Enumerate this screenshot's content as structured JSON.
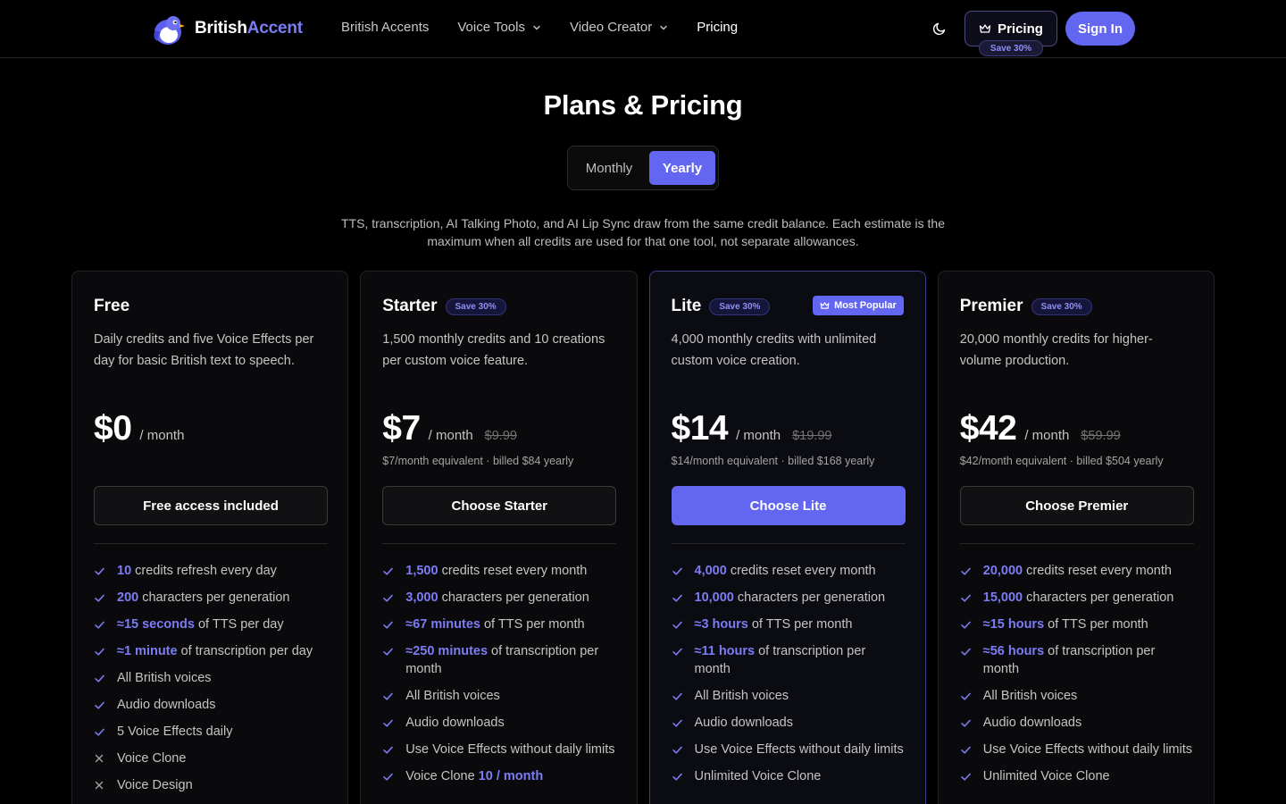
{
  "brand": {
    "name_part1": "British",
    "name_part2": "Accent"
  },
  "nav": {
    "links": [
      {
        "label": "British Accents",
        "dropdown": false
      },
      {
        "label": "Voice Tools",
        "dropdown": true
      },
      {
        "label": "Video Creator",
        "dropdown": true
      },
      {
        "label": "Pricing",
        "dropdown": false,
        "active": true
      }
    ],
    "pricing_button": "Pricing",
    "save_badge": "Save 30%",
    "signin": "Sign In"
  },
  "header": {
    "title": "Plans & Pricing",
    "toggle": {
      "monthly": "Monthly",
      "yearly": "Yearly",
      "selected": "yearly"
    },
    "note": "TTS, transcription, AI Talking Photo, and AI Lip Sync draw from the same credit balance. Each estimate is the maximum when all credits are used for that one tool, not separate allowances."
  },
  "colors": {
    "accent": "#6366f1",
    "accent_text": "#7c7cf5",
    "background": "#000000"
  },
  "plans": [
    {
      "name": "Free",
      "save": "",
      "popular": "",
      "desc": "Daily credits and five Voice Effects per day for basic British text to speech.",
      "price": "$0",
      "per": "/ month",
      "old_price": "",
      "billed": "",
      "cta": "Free access included",
      "primary": false,
      "features": [
        {
          "ok": true,
          "hl": "10",
          "text": " credits refresh every day"
        },
        {
          "ok": true,
          "hl": "200",
          "text": " characters per generation"
        },
        {
          "ok": true,
          "hl": "≈15 seconds",
          "text": " of TTS per day"
        },
        {
          "ok": true,
          "hl": "≈1 minute",
          "text": " of transcription per day"
        },
        {
          "ok": true,
          "hl": "",
          "text": "All British voices"
        },
        {
          "ok": true,
          "hl": "",
          "text": "Audio downloads"
        },
        {
          "ok": true,
          "hl": "",
          "text": "5 Voice Effects daily"
        },
        {
          "ok": false,
          "hl": "",
          "text": "Voice Clone"
        },
        {
          "ok": false,
          "hl": "",
          "text": "Voice Design"
        }
      ]
    },
    {
      "name": "Starter",
      "save": "Save 30%",
      "popular": "",
      "desc": "1,500 monthly credits and 10 creations per custom voice feature.",
      "price": "$7",
      "per": "/ month",
      "old_price": "$9.99",
      "billed": "$7/month equivalent · billed $84 yearly",
      "cta": "Choose Starter",
      "primary": false,
      "features": [
        {
          "ok": true,
          "hl": "1,500",
          "text": " credits reset every month"
        },
        {
          "ok": true,
          "hl": "3,000",
          "text": " characters per generation"
        },
        {
          "ok": true,
          "hl": "≈67 minutes",
          "text": " of TTS per month"
        },
        {
          "ok": true,
          "hl": "≈250 minutes",
          "text": " of transcription per month"
        },
        {
          "ok": true,
          "hl": "",
          "text": "All British voices"
        },
        {
          "ok": true,
          "hl": "",
          "text": "Audio downloads"
        },
        {
          "ok": true,
          "hl": "",
          "text": "Use Voice Effects without daily limits"
        },
        {
          "ok": true,
          "hl": "",
          "text": "Voice Clone ",
          "hl_after": "10 / month"
        }
      ]
    },
    {
      "name": "Lite",
      "save": "Save 30%",
      "popular": "Most Popular",
      "desc": "4,000 monthly credits with unlimited custom voice creation.",
      "price": "$14",
      "per": "/ month",
      "old_price": "$19.99",
      "billed": "$14/month equivalent · billed $168 yearly",
      "cta": "Choose Lite",
      "primary": true,
      "features": [
        {
          "ok": true,
          "hl": "4,000",
          "text": " credits reset every month"
        },
        {
          "ok": true,
          "hl": "10,000",
          "text": " characters per generation"
        },
        {
          "ok": true,
          "hl": "≈3 hours",
          "text": " of TTS per month"
        },
        {
          "ok": true,
          "hl": "≈11 hours",
          "text": " of transcription per month"
        },
        {
          "ok": true,
          "hl": "",
          "text": "All British voices"
        },
        {
          "ok": true,
          "hl": "",
          "text": "Audio downloads"
        },
        {
          "ok": true,
          "hl": "",
          "text": "Use Voice Effects without daily limits"
        },
        {
          "ok": true,
          "hl": "",
          "text": "Unlimited Voice Clone"
        }
      ]
    },
    {
      "name": "Premier",
      "save": "Save 30%",
      "popular": "",
      "desc": "20,000 monthly credits for higher-volume production.",
      "price": "$42",
      "per": "/ month",
      "old_price": "$59.99",
      "billed": "$42/month equivalent · billed $504 yearly",
      "cta": "Choose Premier",
      "primary": false,
      "features": [
        {
          "ok": true,
          "hl": "20,000",
          "text": " credits reset every month"
        },
        {
          "ok": true,
          "hl": "15,000",
          "text": " characters per generation"
        },
        {
          "ok": true,
          "hl": "≈15 hours",
          "text": " of TTS per month"
        },
        {
          "ok": true,
          "hl": "≈56 hours",
          "text": " of transcription per month"
        },
        {
          "ok": true,
          "hl": "",
          "text": "All British voices"
        },
        {
          "ok": true,
          "hl": "",
          "text": "Audio downloads"
        },
        {
          "ok": true,
          "hl": "",
          "text": "Use Voice Effects without daily limits"
        },
        {
          "ok": true,
          "hl": "",
          "text": "Unlimited Voice Clone"
        }
      ]
    }
  ]
}
